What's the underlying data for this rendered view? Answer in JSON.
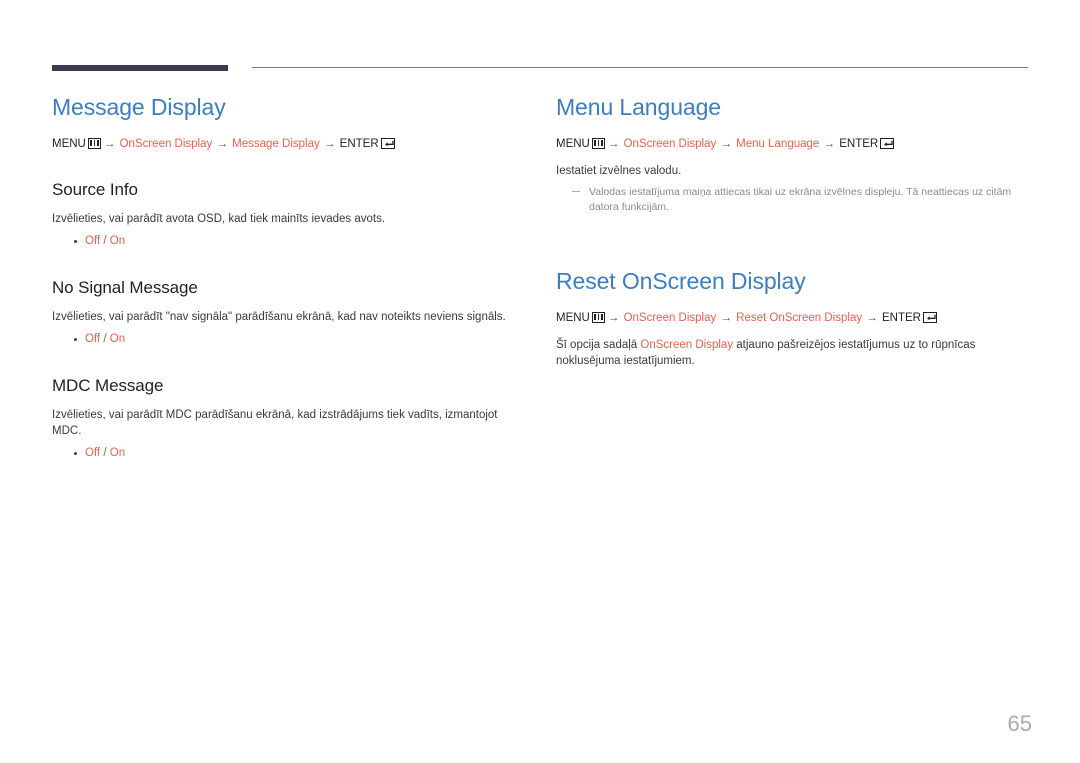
{
  "document": {
    "page_number": "65",
    "colors": {
      "heading_blue": "#3a7ec4",
      "accent_orange": "#e8614d",
      "rule_purple": "#433753",
      "rule_gray": "#77777b",
      "note_gray": "#8b8b8b",
      "page_number_gray": "#a7aab5"
    }
  },
  "left_column": {
    "section": {
      "title": "Message Display",
      "path": {
        "menu_label": "MENU",
        "menu_icon": "menu-box-icon",
        "arrow": "→",
        "crumbs": [
          "OnScreen Display",
          "Message Display"
        ],
        "enter_label": "ENTER",
        "enter_icon": "enter-box-icon"
      }
    },
    "subsections": [
      {
        "title": "Source Info",
        "body": "Izvēlieties, vai parādīt avota OSD, kad tiek mainīts ievades avots.",
        "options": {
          "first": "Off",
          "separator": "/",
          "second": "On"
        }
      },
      {
        "title": "No Signal Message",
        "body": "Izvēlieties, vai parādīt \"nav signāla\" parādīšanu ekrānā, kad nav noteikts neviens signāls.",
        "options": {
          "first": "Off",
          "separator": "/",
          "second": "On"
        }
      },
      {
        "title": "MDC Message",
        "body": "Izvēlieties, vai parādīt MDC parādīšanu ekrānā, kad izstrādājums tiek vadīts, izmantojot MDC.",
        "options": {
          "first": "Off",
          "separator": "/",
          "second": "On"
        }
      }
    ]
  },
  "right_column": {
    "menu_language": {
      "title": "Menu Language",
      "path": {
        "menu_label": "MENU",
        "menu_icon": "menu-box-icon",
        "arrow": "→",
        "crumbs": [
          "OnScreen Display",
          "Menu Language"
        ],
        "enter_label": "ENTER",
        "enter_icon": "enter-box-icon"
      },
      "body": "Iestatiet izvēlnes valodu.",
      "note": "Valodas iestatījuma maiņa attiecas tikai uz ekrāna izvēlnes displeju. Tā neattiecas uz citām datora funkcijām."
    },
    "reset_osd": {
      "title": "Reset OnScreen Display",
      "path": {
        "menu_label": "MENU",
        "menu_icon": "menu-box-icon",
        "arrow": "→",
        "crumbs": [
          "OnScreen Display",
          "Reset OnScreen Display"
        ],
        "enter_label": "ENTER",
        "enter_icon": "enter-box-icon"
      },
      "body_before": "Šī opcija sadaļā ",
      "body_accent": "OnScreen Display",
      "body_after": " atjauno pašreizējos iestatījumus uz to rūpnīcas noklusējuma iestatījumiem."
    }
  }
}
